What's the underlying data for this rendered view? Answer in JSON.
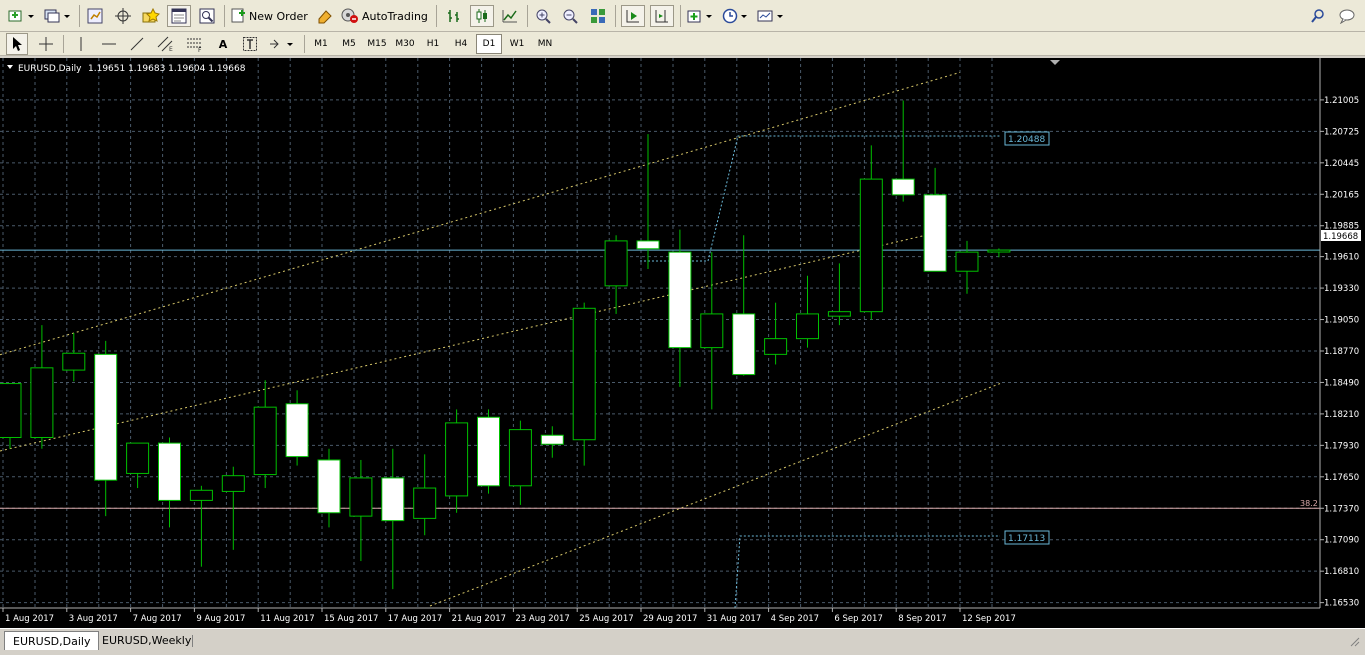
{
  "toolbar": {
    "new_order_label": "New Order",
    "autotrading_label": "AutoTrading",
    "icons": [
      "new-chart-icon",
      "profiles-icon",
      "market-watch-icon",
      "navigator-icon",
      "data-window-icon",
      "terminal-icon",
      "strategy-tester-icon",
      "new-order-icon",
      "metaeditor-icon",
      "autotrading-icon",
      "bar-chart-icon",
      "candlestick-icon",
      "line-chart-icon",
      "zoom-in-icon",
      "zoom-out-icon",
      "tile-windows-icon",
      "autoscroll-icon",
      "chart-shift-icon",
      "indicators-icon",
      "periods-icon",
      "templates-icon",
      "search-icon",
      "chat-icon"
    ]
  },
  "drawing_toolbar": {
    "tools": [
      "cursor-icon",
      "crosshair-icon",
      "vertical-line-icon",
      "horizontal-line-icon",
      "trendline-icon",
      "equidistant-channel-icon",
      "fibonacci-icon",
      "text-icon",
      "text-label-icon",
      "arrows-icon"
    ],
    "text_tool": "A",
    "timeframes": [
      "M1",
      "M5",
      "M15",
      "M30",
      "H1",
      "H4",
      "D1",
      "W1",
      "MN"
    ],
    "active_timeframe": "D1"
  },
  "chart": {
    "symbol_label": "EURUSD,Daily",
    "ohlc_text": "1.19651 1.19683 1.19604 1.19668",
    "current_price_label": "1.19668",
    "fib_level_label": "38.2",
    "upper_marker_label": "1.20488",
    "lower_marker_label": "1.17113",
    "colors": {
      "background": "#000000",
      "grid": "#4a5a6a",
      "bull_fill": "#000000",
      "bear_fill": "#ffffff",
      "wick": "#00c000",
      "channel": "#d8c86a",
      "bid_line": "#6ab8d8",
      "fib_line": "#d9a9a9"
    }
  },
  "chart_data": {
    "type": "candlestick",
    "title": "EURUSD,Daily",
    "ylim": [
      1.165,
      1.212
    ],
    "y_ticks": [
      "1.21005",
      "1.20725",
      "1.20445",
      "1.20165",
      "1.19885",
      "1.19610",
      "1.19330",
      "1.19050",
      "1.18770",
      "1.18490",
      "1.18210",
      "1.17930",
      "1.17650",
      "1.17370",
      "1.17090",
      "1.16810",
      "1.16530"
    ],
    "x_labels": [
      "1 Aug 2017",
      "3 Aug 2017",
      "7 Aug 2017",
      "9 Aug 2017",
      "11 Aug 2017",
      "15 Aug 2017",
      "17 Aug 2017",
      "21 Aug 2017",
      "23 Aug 2017",
      "25 Aug 2017",
      "29 Aug 2017",
      "31 Aug 2017",
      "4 Sep 2017",
      "6 Sep 2017",
      "8 Sep 2017",
      "12 Sep 2017"
    ],
    "candles": [
      {
        "o": 1.18,
        "h": 1.184,
        "l": 1.179,
        "c": 1.1848
      },
      {
        "o": 1.18,
        "h": 1.19,
        "l": 1.179,
        "c": 1.1862
      },
      {
        "o": 1.186,
        "h": 1.1893,
        "l": 1.185,
        "c": 1.1875
      },
      {
        "o": 1.1874,
        "h": 1.1886,
        "l": 1.173,
        "c": 1.1762
      },
      {
        "o": 1.1768,
        "h": 1.1792,
        "l": 1.1755,
        "c": 1.1795
      },
      {
        "o": 1.1795,
        "h": 1.18,
        "l": 1.172,
        "c": 1.1744
      },
      {
        "o": 1.1744,
        "h": 1.1757,
        "l": 1.1685,
        "c": 1.1753
      },
      {
        "o": 1.1752,
        "h": 1.1774,
        "l": 1.17,
        "c": 1.1766
      },
      {
        "o": 1.1767,
        "h": 1.1851,
        "l": 1.1755,
        "c": 1.1827
      },
      {
        "o": 1.183,
        "h": 1.1842,
        "l": 1.1775,
        "c": 1.1783
      },
      {
        "o": 1.178,
        "h": 1.179,
        "l": 1.172,
        "c": 1.1733
      },
      {
        "o": 1.173,
        "h": 1.178,
        "l": 1.169,
        "c": 1.1764
      },
      {
        "o": 1.1764,
        "h": 1.179,
        "l": 1.1665,
        "c": 1.1726
      },
      {
        "o": 1.1728,
        "h": 1.1785,
        "l": 1.1713,
        "c": 1.1755
      },
      {
        "o": 1.1748,
        "h": 1.1825,
        "l": 1.1733,
        "c": 1.1813
      },
      {
        "o": 1.1818,
        "h": 1.1825,
        "l": 1.175,
        "c": 1.1757
      },
      {
        "o": 1.1757,
        "h": 1.1815,
        "l": 1.174,
        "c": 1.1807
      },
      {
        "o": 1.1802,
        "h": 1.181,
        "l": 1.1782,
        "c": 1.1794
      },
      {
        "o": 1.1798,
        "h": 1.192,
        "l": 1.1775,
        "c": 1.1915
      },
      {
        "o": 1.1935,
        "h": 1.198,
        "l": 1.191,
        "c": 1.1975
      },
      {
        "o": 1.1975,
        "h": 1.207,
        "l": 1.195,
        "c": 1.1968
      },
      {
        "o": 1.1965,
        "h": 1.1985,
        "l": 1.1845,
        "c": 1.188
      },
      {
        "o": 1.188,
        "h": 1.1965,
        "l": 1.1825,
        "c": 1.191
      },
      {
        "o": 1.191,
        "h": 1.198,
        "l": 1.1855,
        "c": 1.1856
      },
      {
        "o": 1.1874,
        "h": 1.192,
        "l": 1.1865,
        "c": 1.1888
      },
      {
        "o": 1.1888,
        "h": 1.1944,
        "l": 1.188,
        "c": 1.191
      },
      {
        "o": 1.1908,
        "h": 1.1955,
        "l": 1.19,
        "c": 1.1912
      },
      {
        "o": 1.1912,
        "h": 1.206,
        "l": 1.1905,
        "c": 1.203
      },
      {
        "o": 1.203,
        "h": 1.21,
        "l": 1.201,
        "c": 1.2016
      },
      {
        "o": 1.2016,
        "h": 1.204,
        "l": 1.195,
        "c": 1.1948
      },
      {
        "o": 1.1948,
        "h": 1.1975,
        "l": 1.1928,
        "c": 1.1965
      },
      {
        "o": 1.19651,
        "h": 1.19683,
        "l": 1.19604,
        "c": 1.19668
      }
    ]
  },
  "bottom_tabs": [
    "EURUSD,Daily",
    "EURUSD,Weekly"
  ]
}
